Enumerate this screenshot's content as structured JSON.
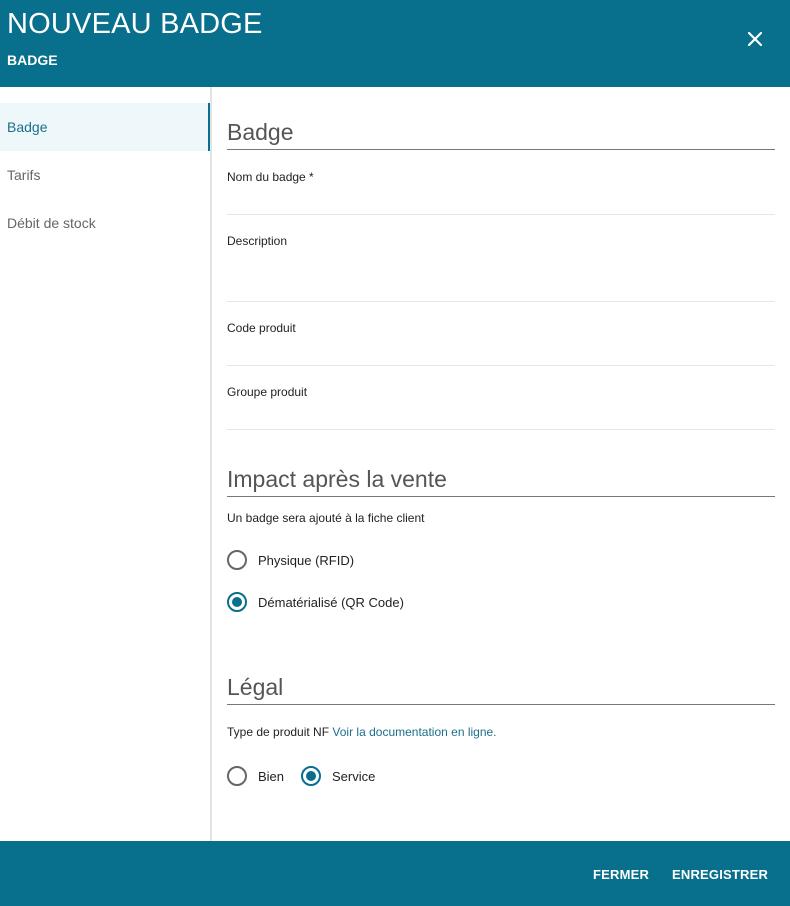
{
  "header": {
    "title": "NOUVEAU BADGE",
    "subtitle": "BADGE",
    "close_icon": "close-icon"
  },
  "sidebar": {
    "items": [
      {
        "label": "Badge",
        "active": true
      },
      {
        "label": "Tarifs",
        "active": false
      },
      {
        "label": "Débit de stock",
        "active": false
      }
    ]
  },
  "badge_section": {
    "title": "Badge",
    "name_label": "Nom du badge *",
    "name_value": "",
    "description_label": "Description",
    "description_value": "",
    "code_label": "Code produit",
    "code_value": "",
    "group_label": "Groupe produit",
    "group_value": ""
  },
  "impact_section": {
    "title": "Impact après la vente",
    "help": "Un badge sera ajouté à la fiche client",
    "options": [
      {
        "label": "Physique (RFID)",
        "checked": false
      },
      {
        "label": "Dématérialisé (QR Code)",
        "checked": true
      }
    ]
  },
  "legal_section": {
    "title": "Légal",
    "help_prefix": "Type de produit NF",
    "help_link": "Voir la documentation en ligne.",
    "options": [
      {
        "label": "Bien",
        "checked": false
      },
      {
        "label": "Service",
        "checked": true
      }
    ]
  },
  "footer": {
    "close_label": "FERMER",
    "save_label": "ENREGISTRER"
  },
  "colors": {
    "primary": "#086f8c",
    "active_bg": "#eef8fb"
  }
}
